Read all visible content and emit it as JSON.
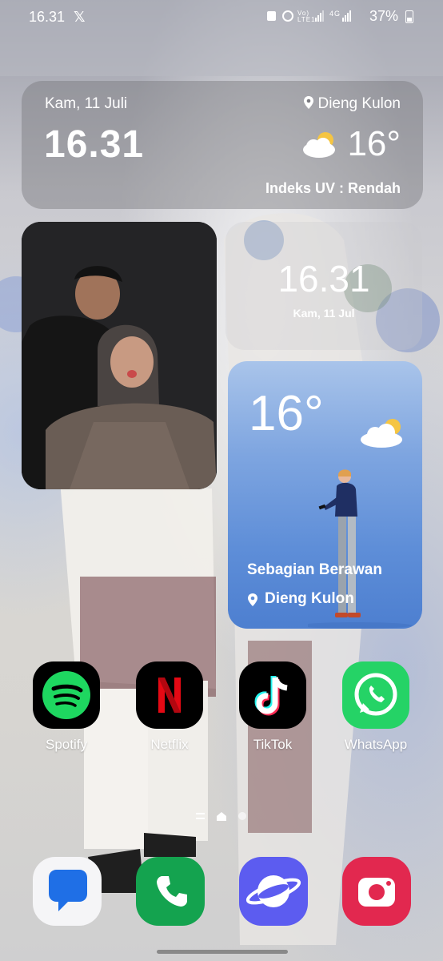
{
  "status_bar": {
    "time": "16.31",
    "notification_icon": "x-icon",
    "indicators": "⏰ Vo) LTE1 ▐ 4G ▐",
    "battery_percent": "37%"
  },
  "time_weather_widget": {
    "date": "Kam, 11 Juli",
    "time": "16.31",
    "location": "Dieng Kulon",
    "temperature": "16°",
    "uv_index": "Indeks UV : Rendah"
  },
  "clock_widget": {
    "time": "16.31",
    "date": "Kam, 11 Jul"
  },
  "weather_widget": {
    "temperature": "16°",
    "condition": "Sebagian Berawan",
    "location": "Dieng Kulon"
  },
  "apps": [
    {
      "label": "Spotify",
      "color": "#000000",
      "icon": "spotify-icon"
    },
    {
      "label": "Netflix",
      "color": "#000000",
      "icon": "netflix-icon"
    },
    {
      "label": "TikTok",
      "color": "#000000",
      "icon": "tiktok-icon"
    },
    {
      "label": "WhatsApp",
      "color": "#25d366",
      "icon": "whatsapp-icon"
    }
  ],
  "dock": [
    {
      "icon": "messages-icon",
      "color": "#2b6ee8"
    },
    {
      "icon": "phone-icon",
      "color": "#1d9d55"
    },
    {
      "icon": "internet-icon",
      "color": "#5c5cf0"
    },
    {
      "icon": "camera-icon",
      "color": "#e2284f"
    }
  ],
  "page_indicator": {
    "pages": 3,
    "current": 2
  }
}
